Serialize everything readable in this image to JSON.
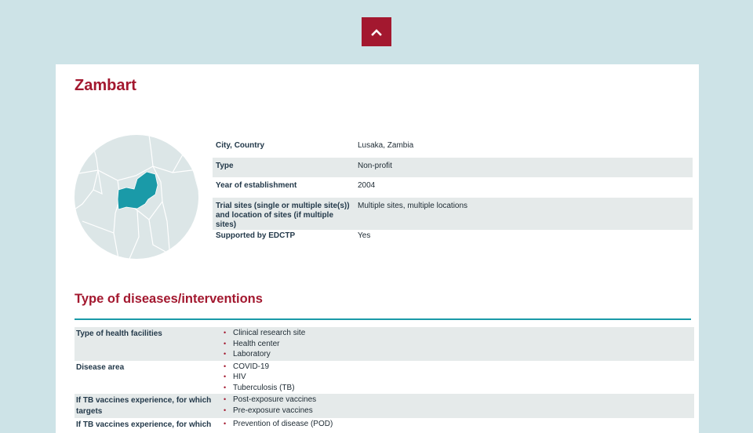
{
  "nav": {
    "back_to_top_icon": "chevron-up-icon"
  },
  "org": {
    "name": "Zambart"
  },
  "map": {
    "icon": "africa-map-zambia-highlight",
    "highlight_color": "#1a9aa8",
    "land_color": "#dce6e7"
  },
  "info": [
    {
      "label": "City, Country",
      "value": "Lusaka, Zambia"
    },
    {
      "label": "Type",
      "value": "Non-profit"
    },
    {
      "label": "Year of establishment",
      "value": "2004"
    },
    {
      "label": "Trial sites (single or multiple site(s)) and location of sites (if multiple sites)",
      "value": "Multiple sites, multiple locations"
    },
    {
      "label": "Supported by EDCTP",
      "value": "Yes"
    }
  ],
  "section": {
    "title": "Type of diseases/interventions"
  },
  "facts": [
    {
      "label": "Type of health facilities",
      "items": [
        "Clinical research site",
        "Health center",
        "Laboratory"
      ]
    },
    {
      "label": "Disease area",
      "items": [
        "COVID-19",
        "HIV",
        "Tuberculosis (TB)"
      ]
    },
    {
      "label": "If TB vaccines experience, for which targets",
      "items": [
        "Post-exposure vaccines",
        "Pre-exposure vaccines"
      ]
    },
    {
      "label": "If TB vaccines experience, for which",
      "items": [
        "Prevention of disease (POD)"
      ]
    }
  ],
  "colors": {
    "brand_red": "#a3182f",
    "teal": "#1a9aa8",
    "bg": "#cde3e7",
    "row_shade": "#e5eaea"
  }
}
